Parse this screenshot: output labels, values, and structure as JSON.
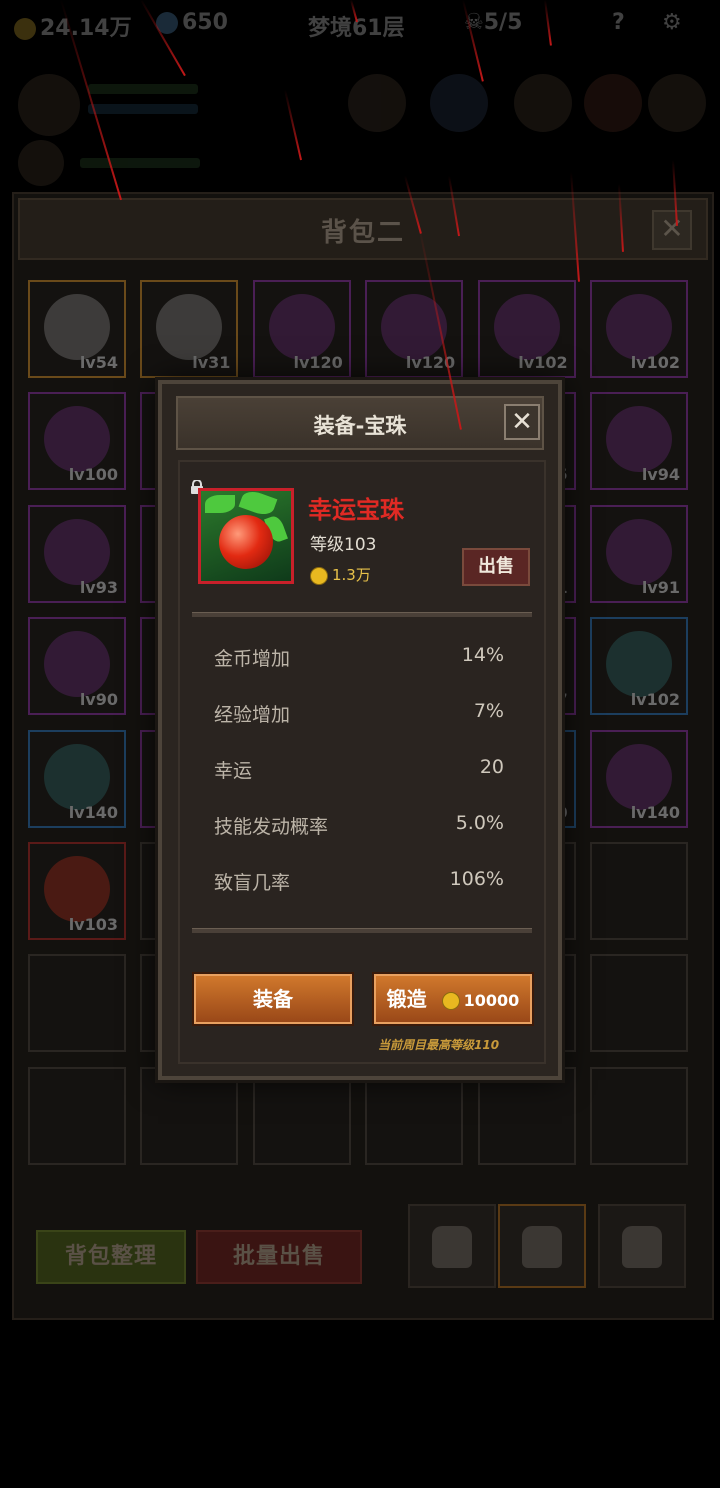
{
  "hud": {
    "gold": "24.14万",
    "gems": "650",
    "stage": "梦境61层",
    "skull": "5/5",
    "help": "?"
  },
  "bag": {
    "title": "背包二",
    "close": "✕",
    "items": [
      {
        "lv": "lv54",
        "rarity": "gold"
      },
      {
        "lv": "lv31",
        "rarity": "gold"
      },
      {
        "lv": "lv120",
        "rarity": "purple"
      },
      {
        "lv": "lv120",
        "rarity": "purple"
      },
      {
        "lv": "lv102",
        "rarity": "purple"
      },
      {
        "lv": "lv102",
        "rarity": "purple"
      },
      {
        "lv": "lv100",
        "rarity": "purple"
      },
      {
        "lv": "",
        "rarity": "purple"
      },
      {
        "lv": "",
        "rarity": ""
      },
      {
        "lv": "",
        "rarity": ""
      },
      {
        "lv": "5",
        "rarity": "purple"
      },
      {
        "lv": "lv94",
        "rarity": "purple"
      },
      {
        "lv": "lv93",
        "rarity": "purple"
      },
      {
        "lv": "",
        "rarity": "purple"
      },
      {
        "lv": "",
        "rarity": ""
      },
      {
        "lv": "",
        "rarity": ""
      },
      {
        "lv": "1",
        "rarity": "purple"
      },
      {
        "lv": "lv91",
        "rarity": "purple"
      },
      {
        "lv": "lv90",
        "rarity": "purple"
      },
      {
        "lv": "",
        "rarity": "purple"
      },
      {
        "lv": "",
        "rarity": ""
      },
      {
        "lv": "",
        "rarity": ""
      },
      {
        "lv": "7",
        "rarity": "purple"
      },
      {
        "lv": "lv102",
        "rarity": "blue"
      },
      {
        "lv": "lv140",
        "rarity": "blue"
      },
      {
        "lv": "",
        "rarity": "purple"
      },
      {
        "lv": "",
        "rarity": ""
      },
      {
        "lv": "",
        "rarity": ""
      },
      {
        "lv": "0",
        "rarity": "blue"
      },
      {
        "lv": "lv140",
        "rarity": "purple"
      },
      {
        "lv": "lv103",
        "rarity": "red"
      },
      {
        "lv": "",
        "rarity": ""
      },
      {
        "lv": "",
        "rarity": ""
      },
      {
        "lv": "",
        "rarity": ""
      },
      {
        "lv": "",
        "rarity": ""
      },
      {
        "lv": "",
        "rarity": ""
      },
      {
        "lv": "",
        "rarity": ""
      },
      {
        "lv": "",
        "rarity": ""
      },
      {
        "lv": "",
        "rarity": ""
      },
      {
        "lv": "",
        "rarity": ""
      },
      {
        "lv": "",
        "rarity": ""
      },
      {
        "lv": "",
        "rarity": ""
      },
      {
        "lv": "",
        "rarity": ""
      },
      {
        "lv": "",
        "rarity": ""
      },
      {
        "lv": "",
        "rarity": ""
      },
      {
        "lv": "",
        "rarity": ""
      },
      {
        "lv": "",
        "rarity": ""
      },
      {
        "lv": "",
        "rarity": ""
      }
    ],
    "sort_button": "背包整理",
    "bulk_sell_button": "批量出售"
  },
  "modal": {
    "title": "装备-宝珠",
    "close": "✕",
    "item_name": "幸运宝珠",
    "item_level": "等级103",
    "item_price": "1.3万",
    "sell_button": "出售",
    "stats": [
      {
        "label": "金币增加",
        "value": "14%"
      },
      {
        "label": "经验增加",
        "value": "7%"
      },
      {
        "label": "幸运",
        "value": "20"
      },
      {
        "label": "技能发动概率",
        "value": "5.0%"
      },
      {
        "label": "致盲几率",
        "value": "106%"
      }
    ],
    "equip_button": "装备",
    "forge_button": "锻造",
    "forge_cost": "10000",
    "hint": "当前周目最高等级110"
  },
  "colors": {
    "item_name": "#e02a24",
    "button": "#c0622a",
    "hint": "#c89a3a"
  }
}
